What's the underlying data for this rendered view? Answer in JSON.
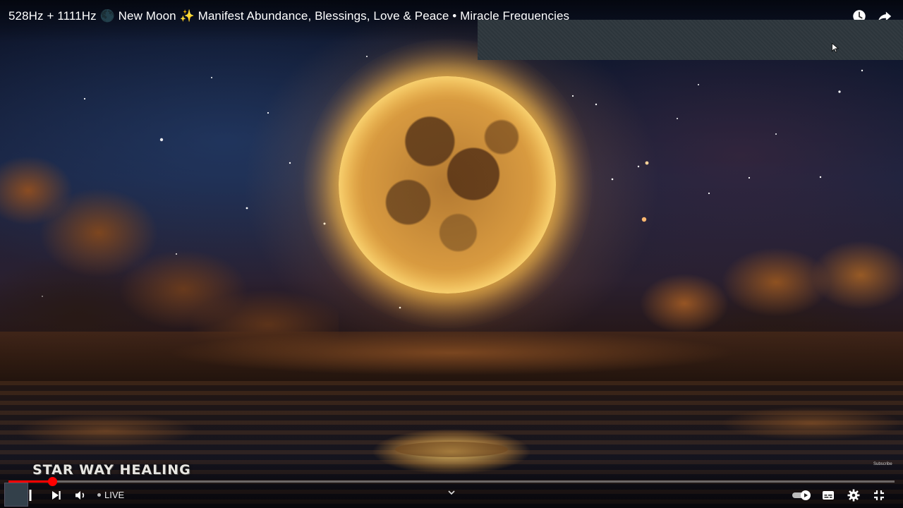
{
  "video": {
    "title": "528Hz + 1111Hz 🌑 New Moon ✨ Manifest Abundance, Blessings, Love & Peace • Miracle Frequencies"
  },
  "watermark": {
    "text": "STAR WAY HEALING"
  },
  "subscribe_mark": {
    "text": "Subscribe"
  },
  "player": {
    "progress_fraction": 0.049,
    "live_label": "LIVE",
    "accent_color": "#ff0000"
  },
  "icons": {
    "watch_later": "clock-icon",
    "share": "share-icon",
    "pause": "pause-icon",
    "next": "next-icon",
    "volume": "volume-icon",
    "chevron": "chevron-down-icon",
    "autoplay": "autoplay-toggle-icon",
    "captions": "captions-icon",
    "settings": "gear-icon",
    "exit_fullscreen": "exit-fullscreen-icon"
  }
}
